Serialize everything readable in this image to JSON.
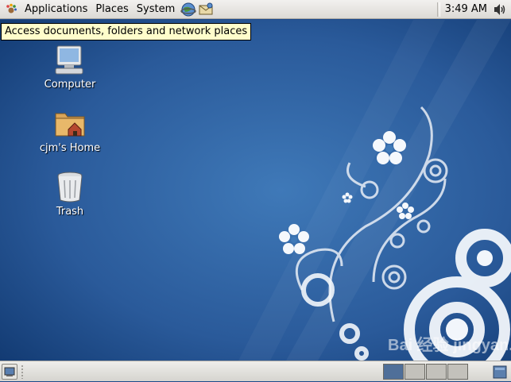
{
  "top_panel": {
    "menus": [
      "Applications",
      "Places",
      "System"
    ],
    "clock": "3:49 AM"
  },
  "tooltip": {
    "text": "Access documents, folders and network places"
  },
  "desktop": {
    "icons": [
      {
        "label": "Computer",
        "icon": "computer-icon"
      },
      {
        "label": "cjm's Home",
        "icon": "home-folder-icon"
      },
      {
        "label": "Trash",
        "icon": "trash-icon"
      }
    ],
    "watermark": "Bai 经验 jingyan.baidu.com"
  },
  "bottom_panel": {
    "workspaces": [
      {
        "name": "workspace-1",
        "active": true,
        "color": "#4f6f99"
      },
      {
        "name": "workspace-2",
        "active": false,
        "color": "#c3c1bb"
      },
      {
        "name": "workspace-3",
        "active": false,
        "color": "#c3c1bb"
      },
      {
        "name": "workspace-4",
        "active": false,
        "color": "#c3c1bb"
      }
    ]
  },
  "colors": {
    "wallpaper_dark": "#123a72",
    "wallpaper_light": "#3f79b8",
    "panel": "#dcdad5",
    "tooltip_bg": "#fffdcb"
  }
}
